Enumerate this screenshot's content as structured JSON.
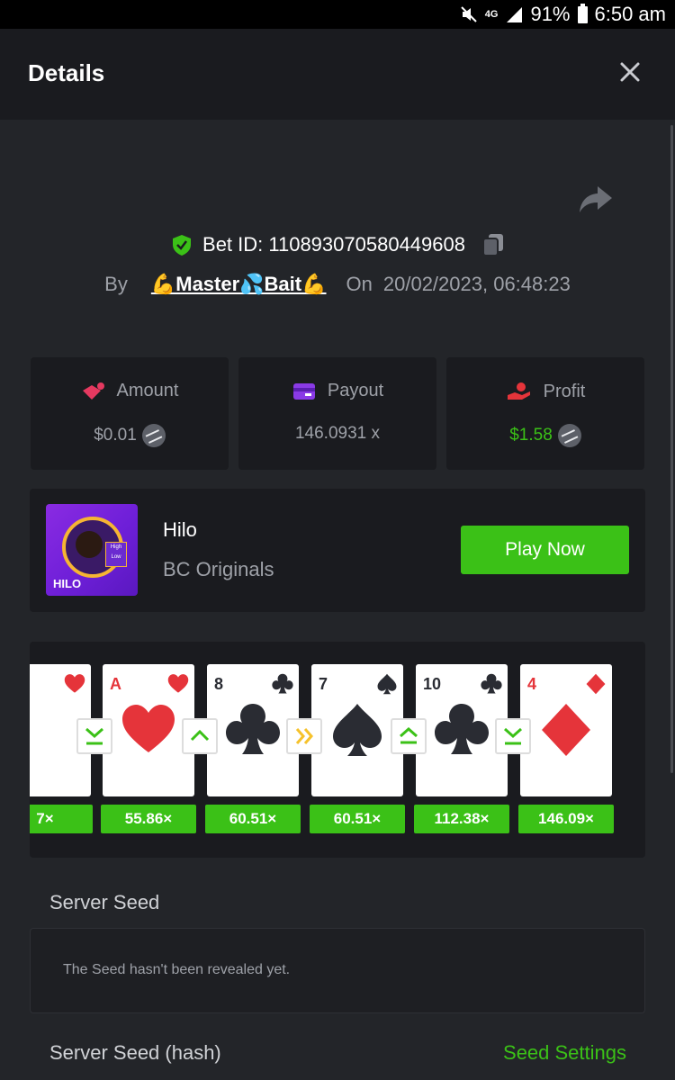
{
  "status_bar": {
    "net": "4G",
    "battery": "91%",
    "time": "6:50 am"
  },
  "header": {
    "title": "Details"
  },
  "bet": {
    "id_label": "Bet ID: 110893070580449608",
    "by_label": "By",
    "user": "💪Master💦Bait💪",
    "on_label": "On",
    "date": "20/02/2023, 06:48:23"
  },
  "stats": [
    {
      "label": "Amount",
      "value": "$0.01",
      "color": "#9ea1a8"
    },
    {
      "label": "Payout",
      "value": "146.0931 x",
      "color": "#9ea1a8"
    },
    {
      "label": "Profit",
      "value": "$1.58",
      "color": "#3bc117"
    }
  ],
  "game": {
    "thumb_text": "HILO",
    "badge_top": "High",
    "badge_bottom": "Low",
    "name": "Hilo",
    "provider": "BC Originals",
    "play_label": "Play Now"
  },
  "cards": [
    {
      "rank": "",
      "suit": "heart",
      "multiplier": "7×"
    },
    {
      "rank": "A",
      "suit": "heart",
      "multiplier": "55.86×"
    },
    {
      "rank": "8",
      "suit": "club",
      "multiplier": "60.51×"
    },
    {
      "rank": "7",
      "suit": "spade",
      "multiplier": "60.51×"
    },
    {
      "rank": "10",
      "suit": "club",
      "multiplier": "112.38×"
    },
    {
      "rank": "4",
      "suit": "diamond",
      "multiplier": "146.09×"
    }
  ],
  "arrows": [
    {
      "type": "lower-or-same"
    },
    {
      "type": "higher"
    },
    {
      "type": "skip"
    },
    {
      "type": "higher-or-same"
    },
    {
      "type": "lower-or-same"
    }
  ],
  "server_seed": {
    "label": "Server Seed",
    "message": "The Seed hasn't been revealed yet."
  },
  "server_seed_hash": {
    "label": "Server Seed (hash)",
    "settings_label": "Seed Settings"
  }
}
